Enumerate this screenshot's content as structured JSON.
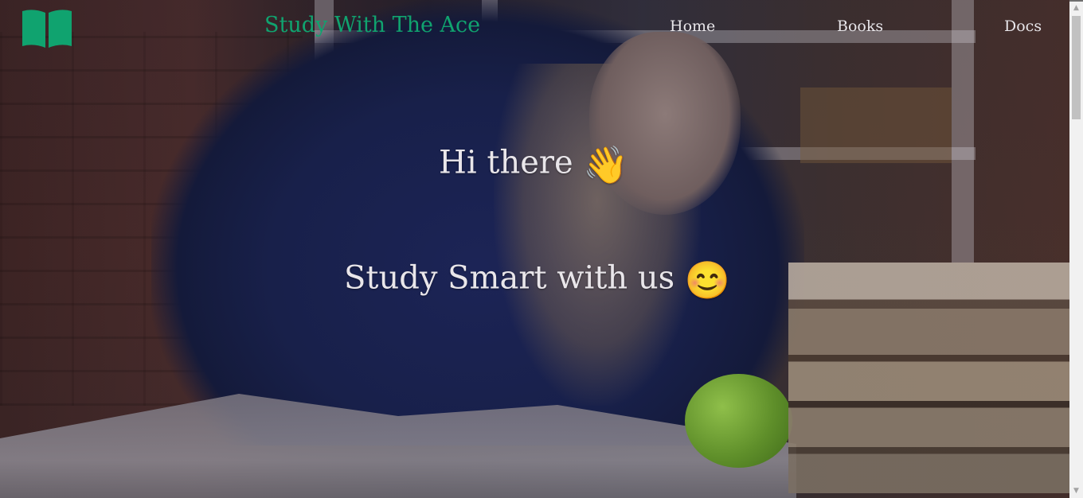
{
  "navbar": {
    "logo_icon": "open-book-icon",
    "brand": "Study With The Ace",
    "links": [
      {
        "label": "Home"
      },
      {
        "label": "Books"
      },
      {
        "label": "Docs"
      }
    ]
  },
  "hero": {
    "line1_text": "Hi there",
    "line1_emoji": "👋",
    "line2_text": "Study Smart with us",
    "line2_emoji": "😊"
  },
  "colors": {
    "brand": "#10a36f",
    "text": "#e9e6ea"
  },
  "scrollbar": {
    "up_arrow": "▲",
    "down_arrow": "▼"
  }
}
